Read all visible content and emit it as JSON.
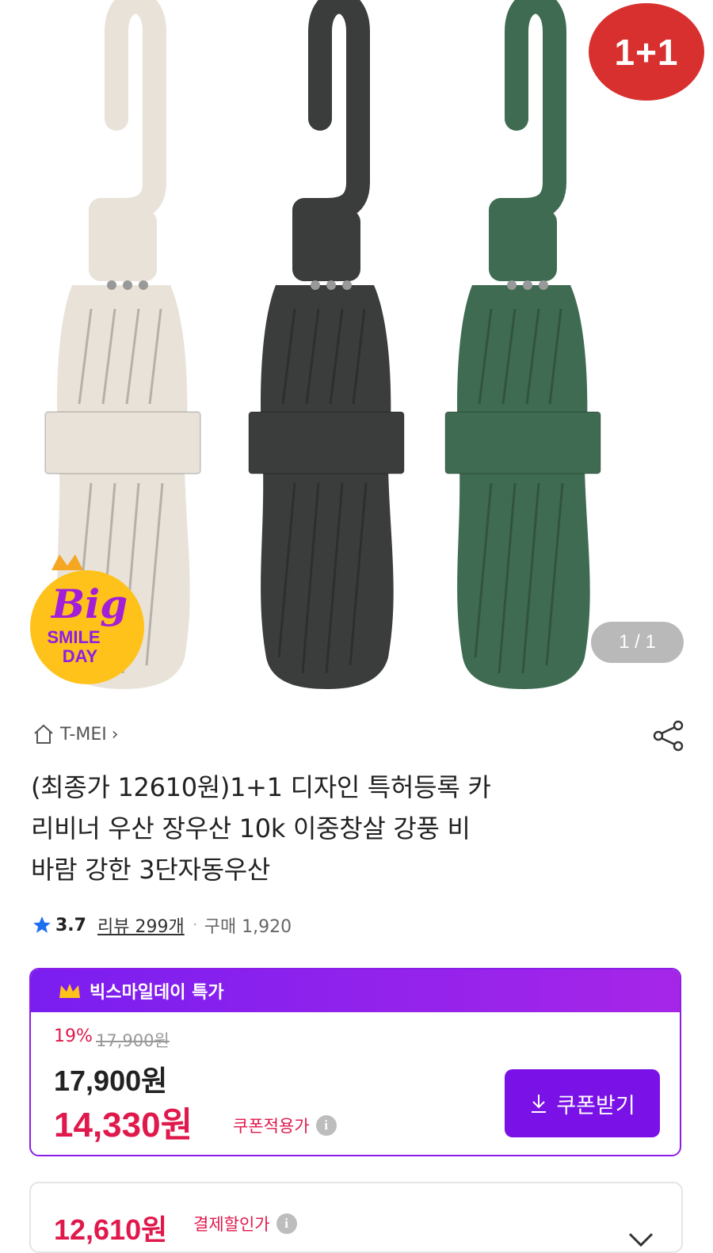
{
  "hero": {
    "promo_badge": "1+1",
    "image_counter": "1 / 1",
    "event_logo": {
      "word": "Big",
      "line1": "SMILE",
      "line2": "DAY"
    },
    "umbrella_colors": [
      "#e8e2d9",
      "#3a3d3b",
      "#3f6b52"
    ]
  },
  "store": {
    "name": "T-MEI",
    "chevron": "›"
  },
  "product": {
    "title_lines": [
      "(최종가 12610원)1+1 디자인 특허등록 카",
      "리비너 우산 장우산 10k 이중창살 강풍 비",
      "바람 강한 3단자동우산"
    ]
  },
  "rating": {
    "score": "3.7",
    "reviews": "리뷰 299개",
    "purchases": "구매 1,920"
  },
  "deal": {
    "header": "빅스마일데이 특가",
    "discount": "19%",
    "original_price": "17,900원",
    "price": "17,900원",
    "coupon_price": "14,330원",
    "coupon_label": "쿠폰적용가",
    "coupon_button": "쿠폰받기"
  },
  "payment": {
    "price": "12,610원",
    "label": "결제할인가"
  },
  "colors": {
    "accent_purple": "#7a12e8",
    "price_red": "#e0194c",
    "badge_red": "#d8302f"
  },
  "icons": [
    "home-icon",
    "share-icon",
    "star-icon",
    "crown-icon",
    "info-icon",
    "download-icon",
    "chevron-down-icon"
  ]
}
